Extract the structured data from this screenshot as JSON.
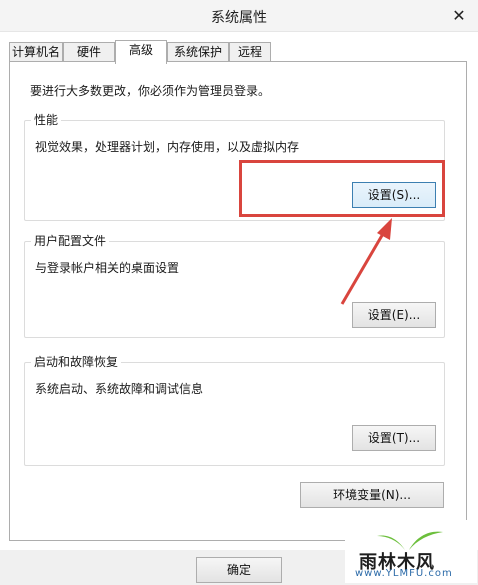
{
  "window": {
    "title": "系统属性",
    "close_label": "✕"
  },
  "tabs": [
    {
      "label": "计算机名"
    },
    {
      "label": "硬件"
    },
    {
      "label": "高级",
      "active": true
    },
    {
      "label": "系统保护"
    },
    {
      "label": "远程"
    }
  ],
  "notice": "要进行大多数更改，你必须作为管理员登录。",
  "performance": {
    "title": "性能",
    "description": "视觉效果，处理器计划，内存使用，以及虚拟内存",
    "button": "设置(S)..."
  },
  "user_profiles": {
    "title": "用户配置文件",
    "description": "与登录帐户相关的桌面设置",
    "button": "设置(E)..."
  },
  "startup_recovery": {
    "title": "启动和故障恢复",
    "description": "系统启动、系统故障和调试信息",
    "button": "设置(T)..."
  },
  "env_vars_button": "环境变量(N)...",
  "footer": {
    "ok_button": "确定"
  },
  "watermark": {
    "brand": "雨林木风",
    "url": "www.YLMFU.com"
  },
  "annotation_color": "#d9453e",
  "icons": {
    "close": "close-icon",
    "arrow": "red-arrow-annotation",
    "logo": "ylmf-logo-icon"
  }
}
